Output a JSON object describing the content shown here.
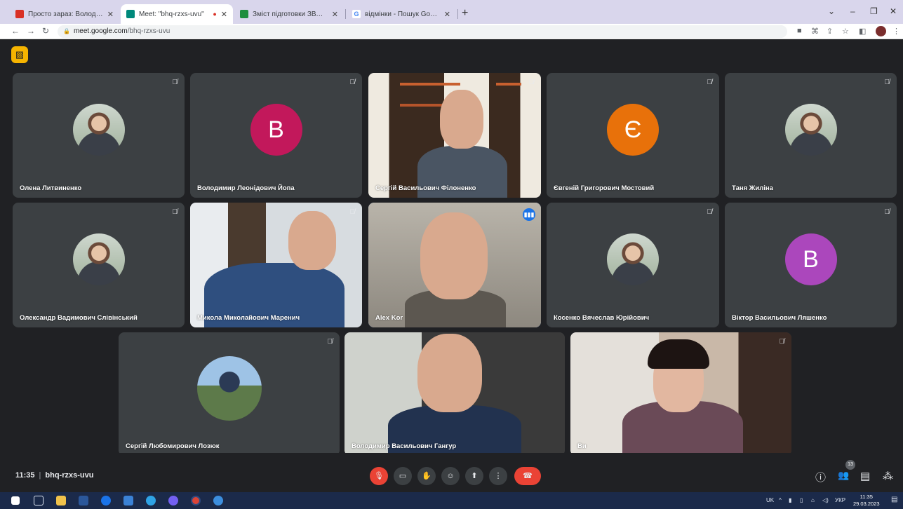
{
  "browser": {
    "tabs": [
      {
        "title": "Просто зараз: Володимир Васи",
        "favicon": "gmail-icon",
        "color": "#d93025"
      },
      {
        "title": "Meet: \"bhq-rzxs-uvu\"",
        "favicon": "meet-icon",
        "color": "#00897b"
      },
      {
        "title": "Зміст підготовки ЗВО за освітні",
        "favicon": "sheets-icon",
        "color": "#1e8e3e"
      },
      {
        "title": "відмінки - Пошук Google",
        "favicon": "google-icon",
        "color": "#4285f4"
      }
    ],
    "new_tab": "+",
    "url_host": "meet.google.com",
    "url_path": "/bhq-rzxs-uvu",
    "window_controls": [
      "⌄",
      "–",
      "❐",
      "✕"
    ]
  },
  "tiles": [
    {
      "name": "Олена Литвиненко",
      "kind": "photo-avatar"
    },
    {
      "name": "Володимир Леонідович Йопа",
      "kind": "letter",
      "letter": "В",
      "color": "#c2185b"
    },
    {
      "name": "Сергій Васильович Філоненко",
      "kind": "video"
    },
    {
      "name": "Євгеній Григорович Мостовий",
      "kind": "letter",
      "letter": "Є",
      "color": "#e8710a"
    },
    {
      "name": "Таня Жиліна",
      "kind": "photo-avatar"
    },
    {
      "name": "Олександр Вадимович Слівінський",
      "kind": "photo-avatar"
    },
    {
      "name": "Микола Миколайович Маренич",
      "kind": "video"
    },
    {
      "name": "Alex Kor",
      "kind": "video"
    },
    {
      "name": "Косенко Вячеслав Юрійович",
      "kind": "photo-avatar"
    },
    {
      "name": "Віктор Васильович Ляшенко",
      "kind": "letter",
      "letter": "В",
      "color": "#ab47bc"
    },
    {
      "name": "Сергій Любомирович Лозюк",
      "kind": "photo-avatar"
    },
    {
      "name": "Володимир Васильович Гангур",
      "kind": "video"
    },
    {
      "name": "Ви",
      "kind": "video"
    }
  ],
  "meeting": {
    "time": "11:35",
    "code": "bhq-rzxs-uvu",
    "participants_count": "13",
    "controls": [
      {
        "icon": "mic-off-icon",
        "glyph": "🎙"
      },
      {
        "icon": "camera-icon",
        "glyph": "▭"
      },
      {
        "icon": "raise-hand-icon",
        "glyph": "✋"
      },
      {
        "icon": "emoji-icon",
        "glyph": "☺"
      },
      {
        "icon": "present-icon",
        "glyph": "⬆"
      },
      {
        "icon": "more-options-icon",
        "glyph": "⋮"
      },
      {
        "icon": "hang-up-icon",
        "glyph": "☎"
      }
    ],
    "right_controls": [
      {
        "icon": "info-icon",
        "glyph": "ⓘ"
      },
      {
        "icon": "people-icon",
        "glyph": "👥"
      },
      {
        "icon": "chat-icon",
        "glyph": "▤"
      },
      {
        "icon": "activities-icon",
        "glyph": "⁂"
      }
    ]
  },
  "taskbar": {
    "language": "UK",
    "keyboard": "УКР",
    "time": "11:35",
    "date": "29.03.2023"
  }
}
